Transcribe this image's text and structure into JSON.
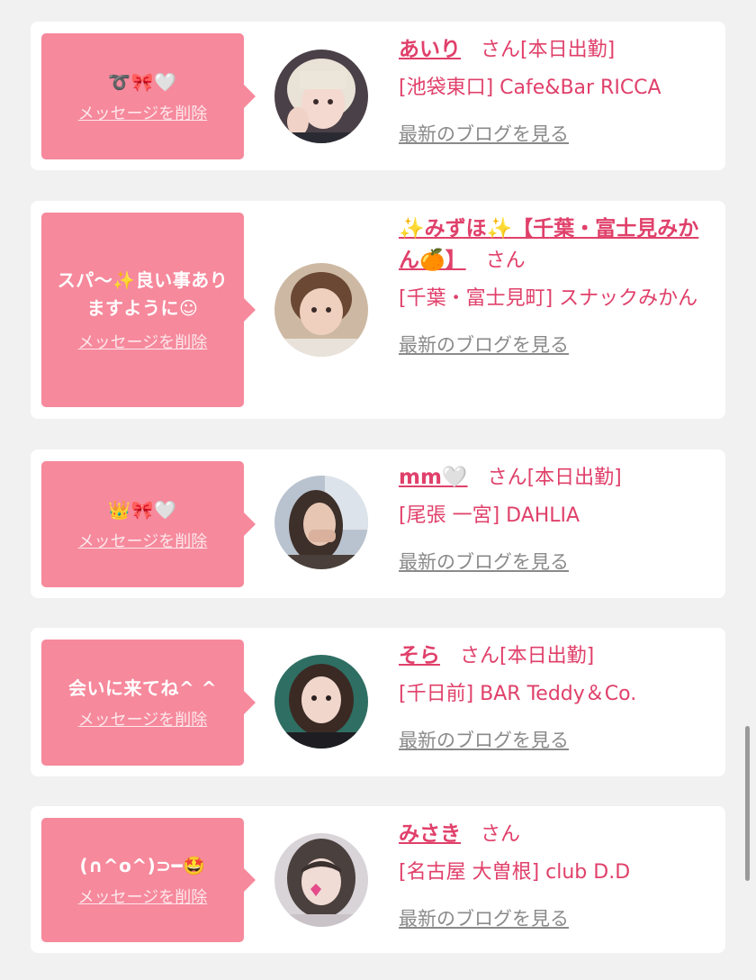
{
  "delete_label": "メッセージを削除",
  "san_label": "さん",
  "blog_label": "最新のブログを見る",
  "cards": [
    {
      "message": "➰🎀🤍",
      "name": "あいり",
      "status": "[本日出勤]",
      "shop": "[池袋東口] Cafe&Bar RICCA"
    },
    {
      "message": "スパ〜✨良い事ありますように☺︎",
      "name": "✨みずほ✨【千葉・富士見みかん🍊】",
      "status": "",
      "shop": "[千葉・富士見町] スナックみかん"
    },
    {
      "message": "👑🎀🤍",
      "name": "mm🤍",
      "status": "[本日出勤]",
      "shop": "[尾張 一宮] DAHLIA"
    },
    {
      "message": "会いに来てね^ ^",
      "name": "そら",
      "status": "[本日出勤]",
      "shop": "[千日前] BAR Teddy＆Co."
    },
    {
      "message": "(∩^o^)⊃━🤩",
      "name": "みさき",
      "status": "",
      "shop": "[名古屋 大曽根] club D.D"
    }
  ],
  "colors": {
    "background": "#f1f1f1",
    "bubble": "#f6899c",
    "accent": "#e0406a",
    "link_gray": "#8a8a8a"
  }
}
